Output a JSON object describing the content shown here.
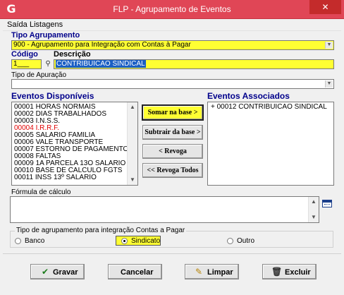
{
  "window": {
    "title": "FLP - Agrupamento de Eventos",
    "icon": "app-logo-icon",
    "close_label": "✕"
  },
  "menu": [
    "Saída",
    "Listagens"
  ],
  "tipo_agrupamento": {
    "label": "Tipo Agrupamento",
    "value": "900 - Agrupamento para Integração com Contas à Pagar"
  },
  "codigo": {
    "label": "Código",
    "value": "1___"
  },
  "descricao": {
    "label": "Descrição",
    "value": "CONTRIBUICAO SINDICAL"
  },
  "tipo_apuracao": {
    "label": "Tipo de Apuração",
    "value": ""
  },
  "eventos_disponiveis": {
    "label": "Eventos Disponíveis",
    "items": [
      {
        "text": "00001 HORAS NORMAIS",
        "color": "#000000"
      },
      {
        "text": "00002 DIAS TRABALHADOS",
        "color": "#000000"
      },
      {
        "text": "00003 I.N.S.S.",
        "color": "#000000"
      },
      {
        "text": "00004 I.R.R.F.",
        "color": "#e00000"
      },
      {
        "text": "00005 SALARIO FAMILIA",
        "color": "#000000"
      },
      {
        "text": "00006 VALE TRANSPORTE",
        "color": "#000000"
      },
      {
        "text": "00007 ESTORNO DE PAGAMENTO",
        "color": "#000000"
      },
      {
        "text": "00008 FALTAS",
        "color": "#000000"
      },
      {
        "text": "00009 1A PARCELA 13O SALARIO",
        "color": "#000000"
      },
      {
        "text": "00010 BASE DE CALCULO FGTS",
        "color": "#000000"
      },
      {
        "text": "00011 INSS 13º SALARIO",
        "color": "#000000"
      }
    ]
  },
  "eventos_associados": {
    "label": "Eventos Associados",
    "items": [
      "+ 00012 CONTRIBUICAO SINDICAL"
    ]
  },
  "buttons_middle": {
    "somar": "Somar na base >",
    "subtrair": "Subtrair da base >",
    "revoga": "< Revoga",
    "revoga_todos": "<< Revoga Todos"
  },
  "formula": {
    "label": "Fórmula de cálculo",
    "value": ""
  },
  "integracao": {
    "legend": "Tipo de agrupamento para integração Contas a Pagar",
    "options": [
      "Banco",
      "Sindicato",
      "Outro"
    ],
    "selected": "Sindicato"
  },
  "footer_buttons": {
    "gravar": "Gravar",
    "cancelar": "Cancelar",
    "limpar": "Limpar",
    "excluir": "Excluir"
  }
}
